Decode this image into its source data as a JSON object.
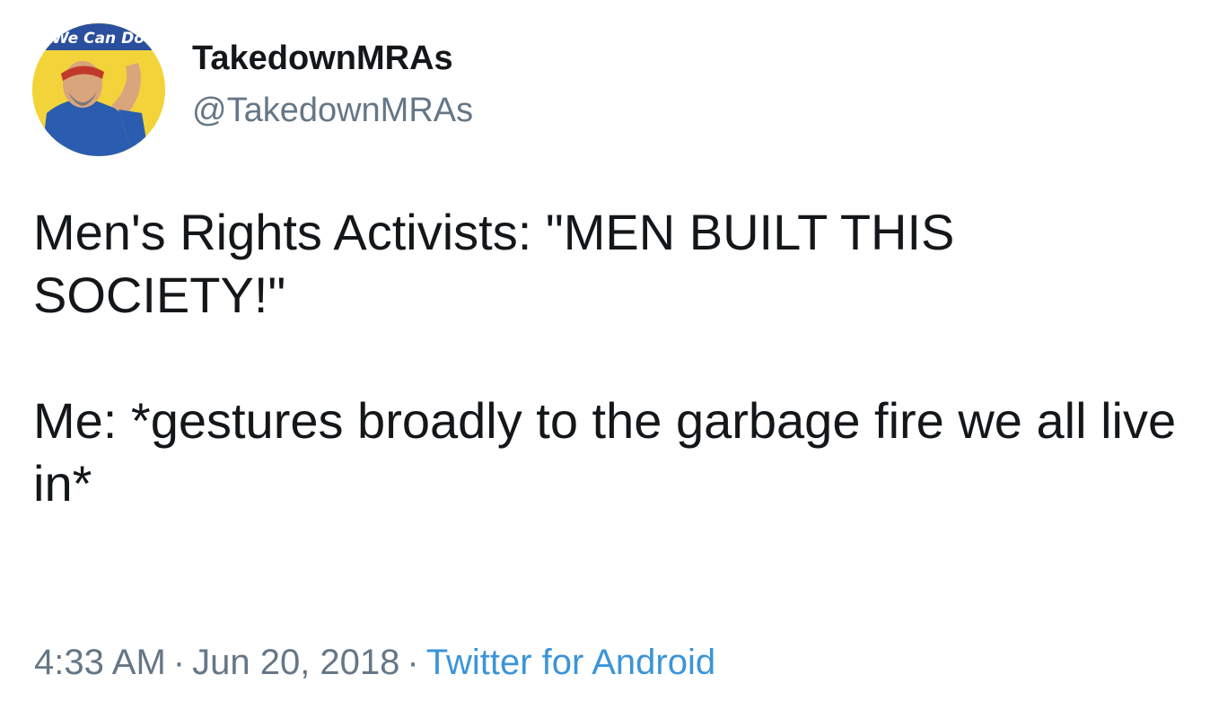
{
  "tweet": {
    "author": {
      "display_name": "TakedownMRAs",
      "handle": "@TakedownMRAs",
      "avatar_banner_text": "We Can Do It"
    },
    "text_line_1": "Men's Rights Activists: \"MEN BUILT THIS SOCIETY!\"",
    "text_line_2": "Me: *gestures broadly to the garbage fire we all live in*",
    "time": "4:33 AM",
    "separator": "·",
    "date": "Jun 20, 2018",
    "source": "Twitter for Android"
  },
  "colors": {
    "text_primary": "#14171a",
    "text_secondary": "#657786",
    "link": "#3b94d9",
    "avatar_background": "#f2d43a",
    "avatar_shirt": "#2a5db0"
  }
}
